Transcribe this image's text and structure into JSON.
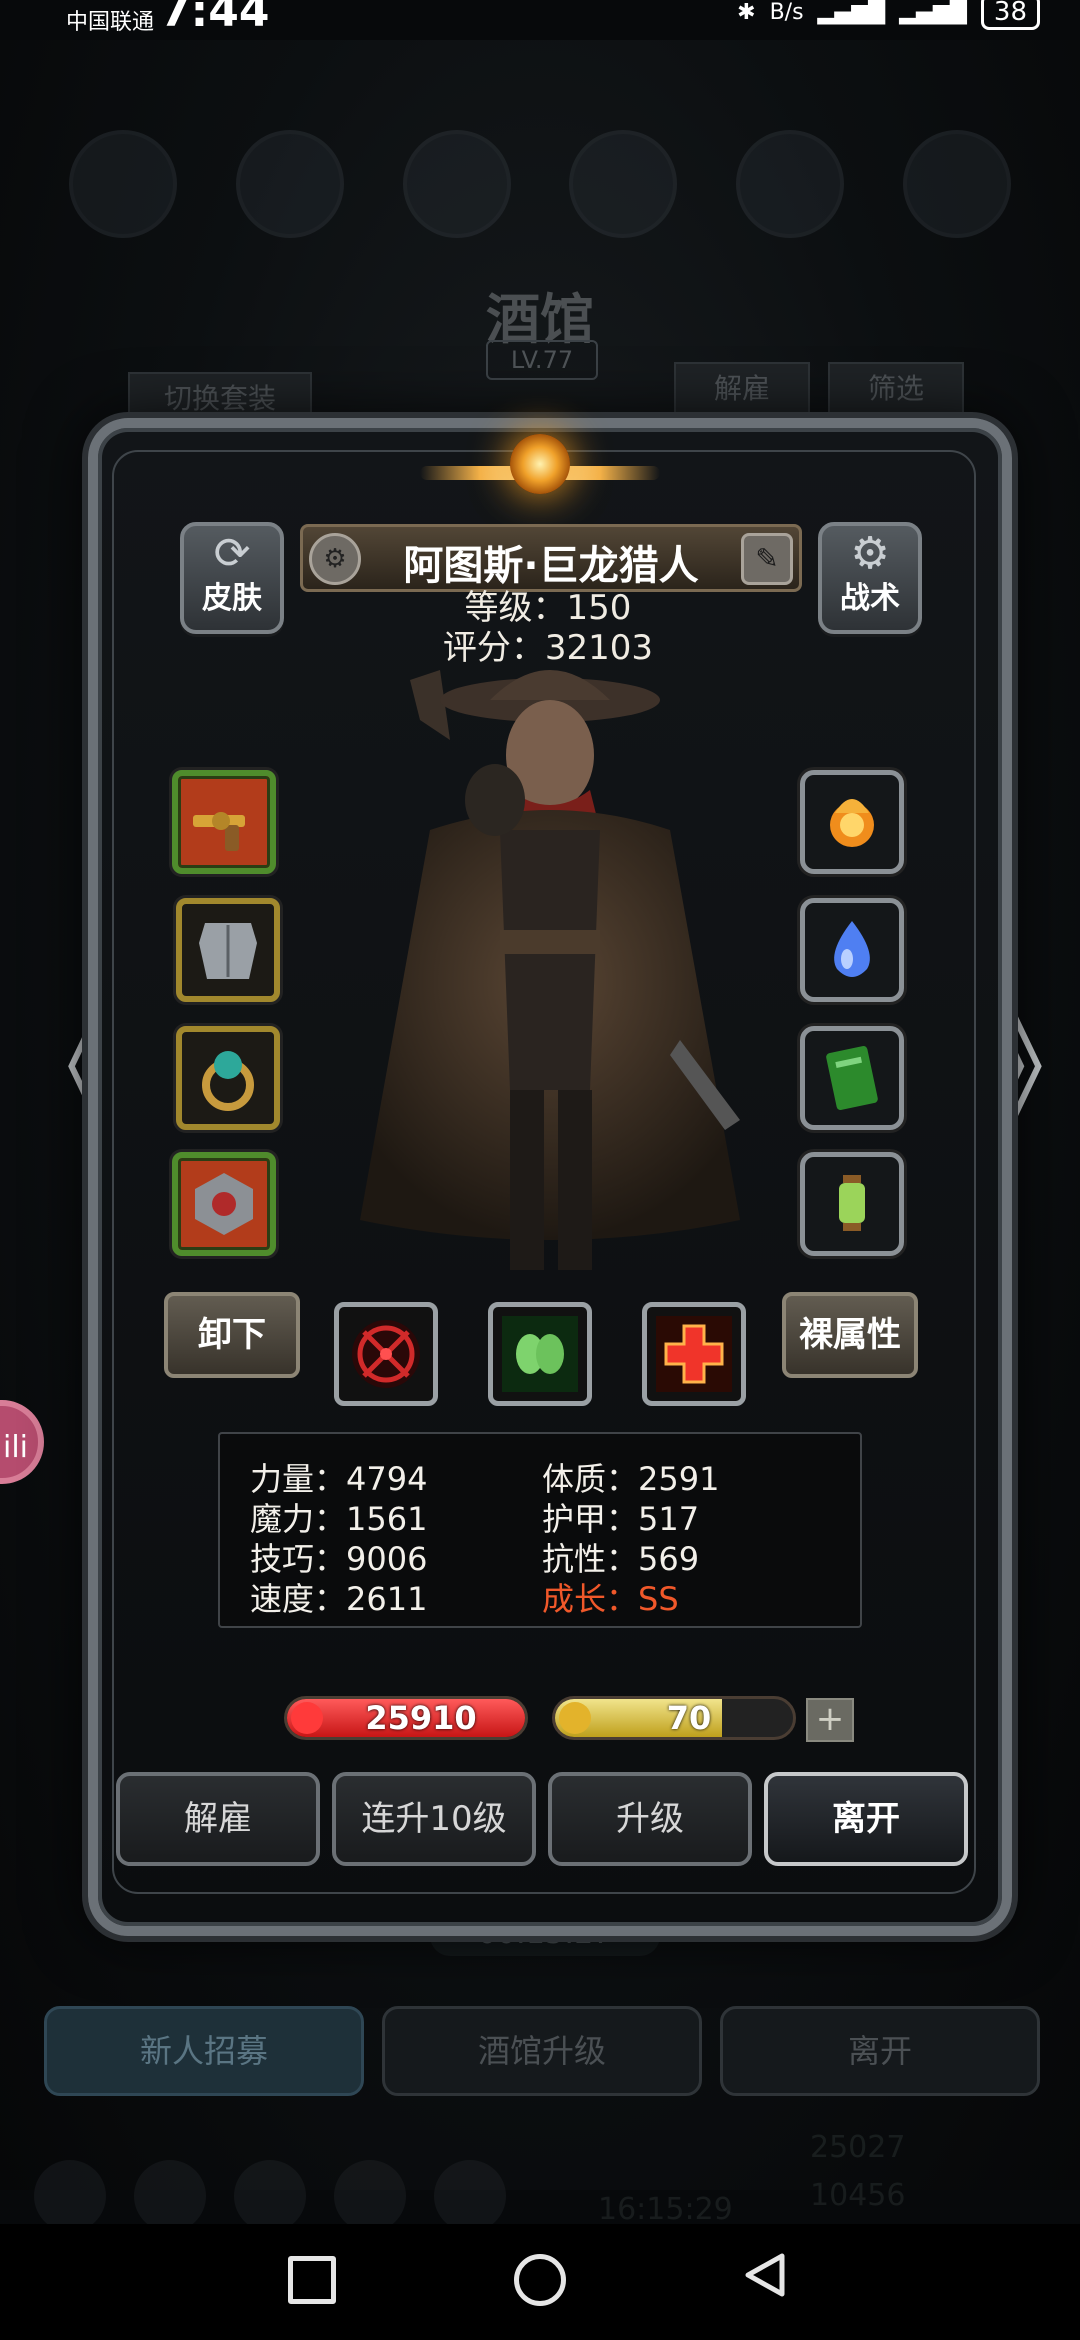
{
  "status_bar": {
    "carrier": "中国联通",
    "time": "7:44",
    "signal_info": "B/s",
    "battery": "38"
  },
  "background": {
    "title": "酒馆",
    "level": "LV.77",
    "switch_outfit": "切换套装",
    "dismiss": "解雇",
    "filter": "筛选",
    "timer": "00:15:27",
    "bottom_buttons": [
      "新人招募",
      "酒馆升级",
      "离开"
    ],
    "coins": "25027",
    "gems": "10456",
    "clock": "16:15:29"
  },
  "hero": {
    "name": "阿图斯·巨龙猎人",
    "level_text": "等级：150",
    "score_text": "评分：32103"
  },
  "buttons": {
    "skin": "皮肤",
    "tactics": "战术",
    "unequip": "卸下",
    "naked_attributes": "裸属性",
    "prev_glyph": "《",
    "next_glyph": "》",
    "plate_pin": "⚙",
    "plate_edit": "✎"
  },
  "icons": {
    "left_slots": [
      "revolver-icon",
      "armor-icon",
      "ring-icon",
      "amulet-icon"
    ],
    "right_slots": [
      "fire-orb-icon",
      "water-drop-icon",
      "green-card-icon",
      "lantern-icon"
    ],
    "skills": [
      "red-target-skill-icon",
      "green-skull-skill-icon",
      "red-cross-skill-icon"
    ]
  },
  "stats": {
    "strength": "力量：4794",
    "magic": "魔力：1561",
    "skill": "技巧：9006",
    "speed": "速度：2611",
    "constitution": "体质：2591",
    "armor": "护甲：517",
    "resistance": "抗性：569",
    "growth": "成长：SS"
  },
  "bars": {
    "hp_value": "25910",
    "hp_fill": 1.0,
    "energy_value": "70",
    "energy_fill": 0.7,
    "plus": "+"
  },
  "actions": [
    "解雇",
    "连升10级",
    "升级",
    "离开"
  ],
  "colors": {
    "growth": "#f0582a",
    "hp": "#d41f1f",
    "energy": "#d8c03a"
  }
}
